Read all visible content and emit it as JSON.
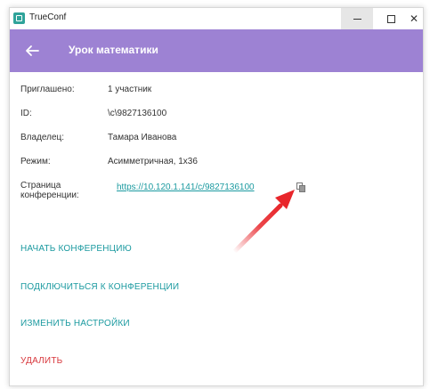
{
  "window": {
    "app_title": "TrueConf",
    "controls": {
      "minimize": "",
      "maximize": "",
      "close": "✕"
    }
  },
  "header": {
    "title": "Урок математики",
    "accent_color": "#9d82d3"
  },
  "details": [
    {
      "label": "Приглашено:",
      "value": "1 участник"
    },
    {
      "label": "ID:",
      "value": "\\c\\9827136100"
    },
    {
      "label": "Владелец:",
      "value": "Тамара Иванова"
    },
    {
      "label": "Режим:",
      "value": "Асимметричная, 1x36"
    }
  ],
  "conference_page": {
    "label_line1": "Страница",
    "label_line2": "конференции:",
    "url": "https://10.120.1.141/c/9827136100",
    "copy_icon": "copy-icon"
  },
  "actions": {
    "start": "НАЧАТЬ КОНФЕРЕНЦИЮ",
    "join": "ПОДКЛЮЧИТЬСЯ К КОНФЕРЕНЦИИ",
    "settings": "ИЗМЕНИТЬ НАСТРОЙКИ",
    "delete": "УДАЛИТЬ"
  },
  "colors": {
    "link": "#1b9aa0",
    "danger": "#d8383d",
    "annotation_arrow": "#e8262b"
  }
}
